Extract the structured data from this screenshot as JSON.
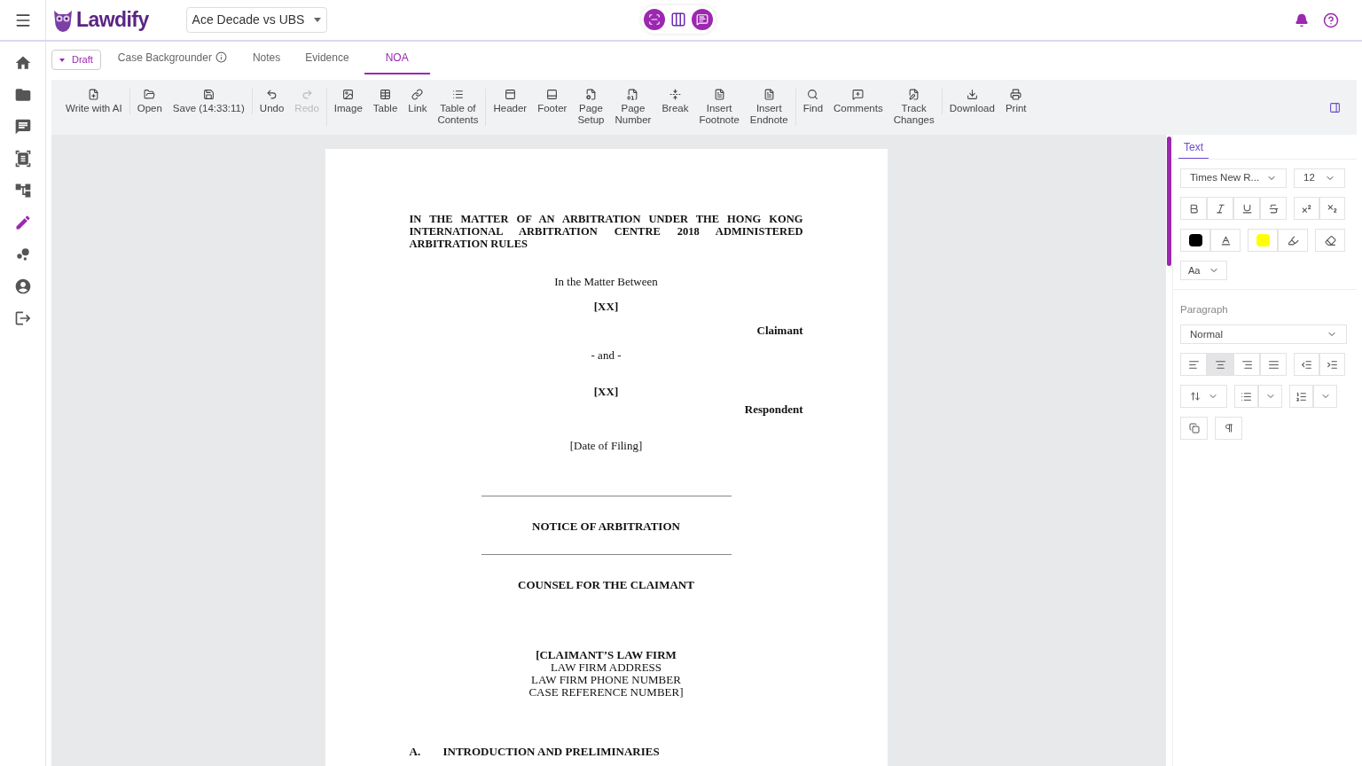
{
  "header": {
    "logo": "Lawdify",
    "case_selector": "Ace Decade vs UBS"
  },
  "sidebar": [
    {
      "selected": false
    },
    {
      "selected": false
    },
    {
      "selected": false
    },
    {
      "selected": false
    },
    {
      "selected": false
    },
    {
      "selected": true
    },
    {
      "selected": false
    },
    {
      "selected": false
    },
    {
      "selected": false
    }
  ],
  "draft_button": "Draft",
  "tabs": [
    {
      "label": "Case Backgrounder",
      "info": true,
      "selected": false
    },
    {
      "label": "Notes",
      "info": false,
      "selected": false
    },
    {
      "label": "Evidence",
      "info": false,
      "selected": false
    },
    {
      "label": "NOA",
      "info": false,
      "selected": true
    }
  ],
  "toolbar": [
    [
      {
        "label": "Write with AI",
        "disabled": false
      }
    ],
    [
      {
        "label": "Open",
        "disabled": false
      },
      {
        "label": "Save (14:33:11)",
        "disabled": false
      }
    ],
    [
      {
        "label": "Undo",
        "disabled": false
      },
      {
        "label": "Redo",
        "disabled": true
      }
    ],
    [
      {
        "label": "Image",
        "disabled": false
      },
      {
        "label": "Table",
        "disabled": false
      },
      {
        "label": "Link",
        "disabled": false
      },
      {
        "label": "Table of\nContents",
        "disabled": false
      }
    ],
    [
      {
        "label": "Header",
        "disabled": false
      },
      {
        "label": "Footer",
        "disabled": false
      },
      {
        "label": "Page\nSetup",
        "disabled": false
      },
      {
        "label": "Page\nNumber",
        "disabled": false
      },
      {
        "label": "Break",
        "disabled": false
      },
      {
        "label": "Insert\nFootnote",
        "disabled": false
      },
      {
        "label": "Insert\nEndnote",
        "disabled": false
      }
    ],
    [
      {
        "label": "Find",
        "disabled": false
      },
      {
        "label": "Comments",
        "disabled": false
      },
      {
        "label": "Track\nChanges",
        "disabled": false
      }
    ],
    [
      {
        "label": "Download",
        "disabled": false
      },
      {
        "label": "Print",
        "disabled": false
      }
    ]
  ],
  "document": [
    {
      "kind": "title",
      "text": "IN THE MATTER OF AN ARBITRATION UNDER THE HONG KONG INTERNATIONAL ARBITRATION CENTRE 2018 ADMINISTERED ARBITRATION RULES"
    },
    {
      "kind": "center",
      "text": "In the Matter Between"
    },
    {
      "kind": "center_bold",
      "text": "[XX]"
    },
    {
      "kind": "right_bold",
      "text": "Claimant"
    },
    {
      "kind": "center",
      "text": "- and -"
    },
    {
      "kind": "center_bold",
      "text": "[XX]"
    },
    {
      "kind": "right_bold",
      "text": "Respondent"
    },
    {
      "kind": "center",
      "text": "[Date of Filing]"
    },
    {
      "kind": "rule"
    },
    {
      "kind": "center_bold",
      "text": "NOTICE OF ARBITRATION"
    },
    {
      "kind": "rule"
    },
    {
      "kind": "center_bold",
      "text": "COUNSEL FOR THE CLAIMANT"
    },
    {
      "kind": "address",
      "lines": [
        "[CLAIMANT’S LAW FIRM",
        "LAW FIRM ADDRESS",
        "LAW FIRM PHONE NUMBER",
        "CASE REFERENCE NUMBER]"
      ]
    },
    {
      "kind": "section",
      "number": "A.",
      "text": "INTRODUCTION AND PRELIMINARIES"
    }
  ],
  "panel": {
    "tab": {
      "label": "Text",
      "selected": true
    },
    "font": "Times New R...",
    "size": "12",
    "case_button": "Aa",
    "paragraph_label": "Paragraph",
    "style": "Normal",
    "align": [
      {
        "selected": false
      },
      {
        "selected": true
      },
      {
        "selected": false
      },
      {
        "selected": false
      }
    ]
  }
}
